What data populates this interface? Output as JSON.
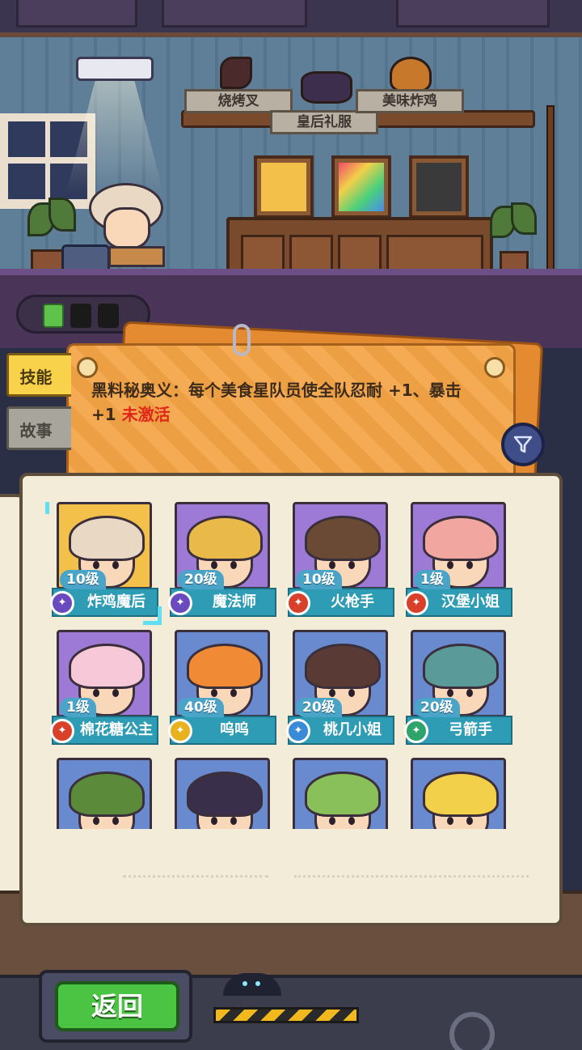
{
  "room": {
    "shelf_labels": [
      "烧烤叉",
      "皇后礼服",
      "美味炸鸡"
    ]
  },
  "energy": {
    "charged": 1,
    "total": 3
  },
  "side_tabs": [
    {
      "label": "技能",
      "active": true
    },
    {
      "label": "故事",
      "active": false
    }
  ],
  "skill": {
    "description": "黑料秘奥义：每个美食星队员使全队忍耐 +1、暴击 +1",
    "status": "未激活"
  },
  "characters": [
    {
      "level": "10级",
      "name": "炸鸡魔后",
      "selected": true,
      "bg": "#f3c14a",
      "hair": "#e9d8c4",
      "badge_color": "#6a4bbf"
    },
    {
      "level": "20级",
      "name": "魔法师",
      "selected": false,
      "bg": "#9d7ad6",
      "hair": "#e9b94a",
      "badge_color": "#6a4bbf"
    },
    {
      "level": "10级",
      "name": "火枪手",
      "selected": false,
      "bg": "#9d7ad6",
      "hair": "#6a4a34",
      "badge_color": "#d9402a"
    },
    {
      "level": "1级",
      "name": "汉堡小姐",
      "selected": false,
      "bg": "#9d7ad6",
      "hair": "#f2a6a0",
      "badge_color": "#d9402a"
    },
    {
      "level": "1级",
      "name": "棉花糖公主",
      "selected": false,
      "bg": "#9d7ad6",
      "hair": "#f6c8d8",
      "badge_color": "#d9402a"
    },
    {
      "level": "40级",
      "name": "呜呜",
      "selected": false,
      "bg": "#6a8ad0",
      "hair": "#f08a34",
      "badge_color": "#e8b21e"
    },
    {
      "level": "20级",
      "name": "桃几小姐",
      "selected": false,
      "bg": "#6a8ad0",
      "hair": "#5a3a34",
      "badge_color": "#3a8ad8"
    },
    {
      "level": "20级",
      "name": "弓箭手",
      "selected": false,
      "bg": "#6a8ad0",
      "hair": "#5a9a98",
      "badge_color": "#2ea46a"
    },
    {
      "level": "",
      "name": "",
      "selected": false,
      "bg": "#6a8ad0",
      "hair": "#5a8a3a",
      "badge_color": "#2ea46a"
    },
    {
      "level": "",
      "name": "",
      "selected": false,
      "bg": "#6a8ad0",
      "hair": "#3a2f4a",
      "badge_color": "#2ea46a"
    },
    {
      "level": "",
      "name": "",
      "selected": false,
      "bg": "#6a8ad0",
      "hair": "#8ac05a",
      "badge_color": "#2ea46a"
    },
    {
      "level": "",
      "name": "",
      "selected": false,
      "bg": "#6a8ad0",
      "hair": "#f2d04a",
      "badge_color": "#2ea46a"
    }
  ],
  "back_button": {
    "label": "返回"
  },
  "icons": {
    "filter": "filter-icon",
    "battery": "battery-icon"
  }
}
